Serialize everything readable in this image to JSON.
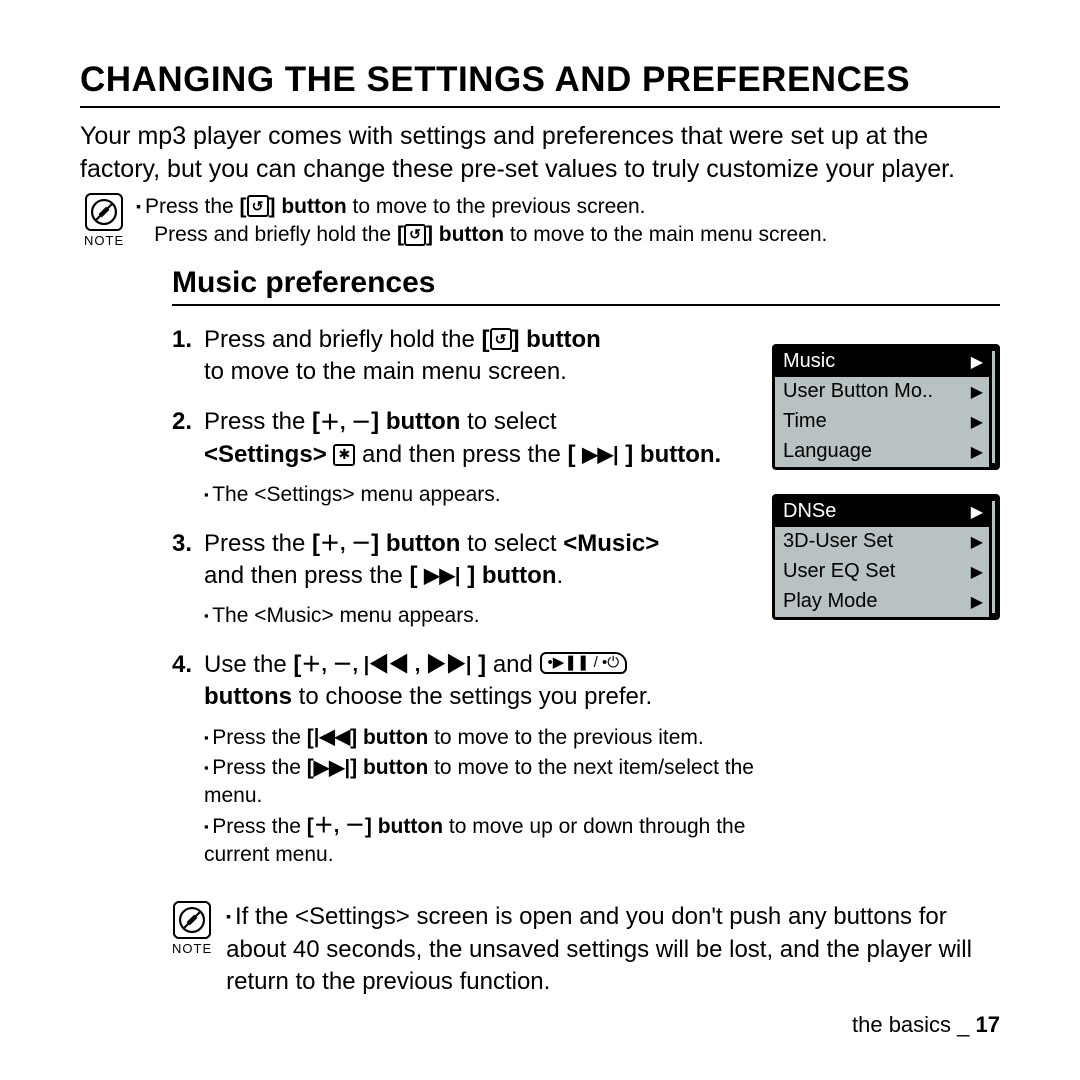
{
  "title": "CHANGING THE SETTINGS AND PREFERENCES",
  "intro": "Your mp3 player comes with settings and preferences that were set up at the factory, but you can change these pre-set values to truly customize your player.",
  "note1": {
    "label": "NOTE",
    "line1_a": "Press the ",
    "line1_b": "] button",
    "line1_c": " to move to the previous screen.",
    "line2_a": "Press and briefly hold the ",
    "line2_b": "] button",
    "line2_c": " to move to the main menu screen."
  },
  "subtitle": "Music preferences",
  "steps": {
    "s1_a": "Press and briefly hold the ",
    "s1_b": "] button",
    "s1_c": "to move to the main menu screen.",
    "s2_a": "Press the ",
    "s2_b": "] button",
    "s2_c": " to select",
    "s2_d": "<Settings>",
    "s2_e": " and then press the ",
    "s2_f": "] button.",
    "s2_sub": "The <Settings> menu appears.",
    "s3_a": "Press the ",
    "s3_b": "] button",
    "s3_c": " to select ",
    "s3_d": "<Music>",
    "s3_e": "and then press the ",
    "s3_f": "] button",
    "s3_sub": "The <Music> menu appears.",
    "s4_a": "Use the ",
    "s4_b": "]",
    "s4_c": " and ",
    "s4_d": "buttons",
    "s4_e": " to choose the settings you prefer.",
    "s4_sub1_a": "Press the ",
    "s4_sub1_b": "] button",
    "s4_sub1_c": " to move to the previous item.",
    "s4_sub2_a": "Press the ",
    "s4_sub2_b": "] button",
    "s4_sub2_c": " to move to the next item/select the menu.",
    "s4_sub3_a": "Press the ",
    "s4_sub3_b": "] button",
    "s4_sub3_c": " to move up or down through the current menu."
  },
  "note2": {
    "label": "NOTE",
    "text": "If the <Settings> screen is open and you don't push any buttons for about 40 seconds, the unsaved settings will be lost, and the player will return to the previous function."
  },
  "menu1": {
    "header": "Music",
    "items": [
      "User Button Mo..",
      "Time",
      "Language"
    ]
  },
  "menu2": {
    "header": "DNSe",
    "items": [
      "3D-User Set",
      "User EQ Set",
      "Play Mode"
    ]
  },
  "glyphs": {
    "back": "↺",
    "plusminus": "＋, －",
    "plusminus_b": "＋, －",
    "next": "▶▶|",
    "prev": "|◀◀",
    "nav4": "＋, －, |◀◀ , ▶▶|",
    "playpower": "•▶❚❚ / •⏻",
    "gear": "✱"
  },
  "footer": {
    "section": "the basics _ ",
    "page": "17"
  }
}
